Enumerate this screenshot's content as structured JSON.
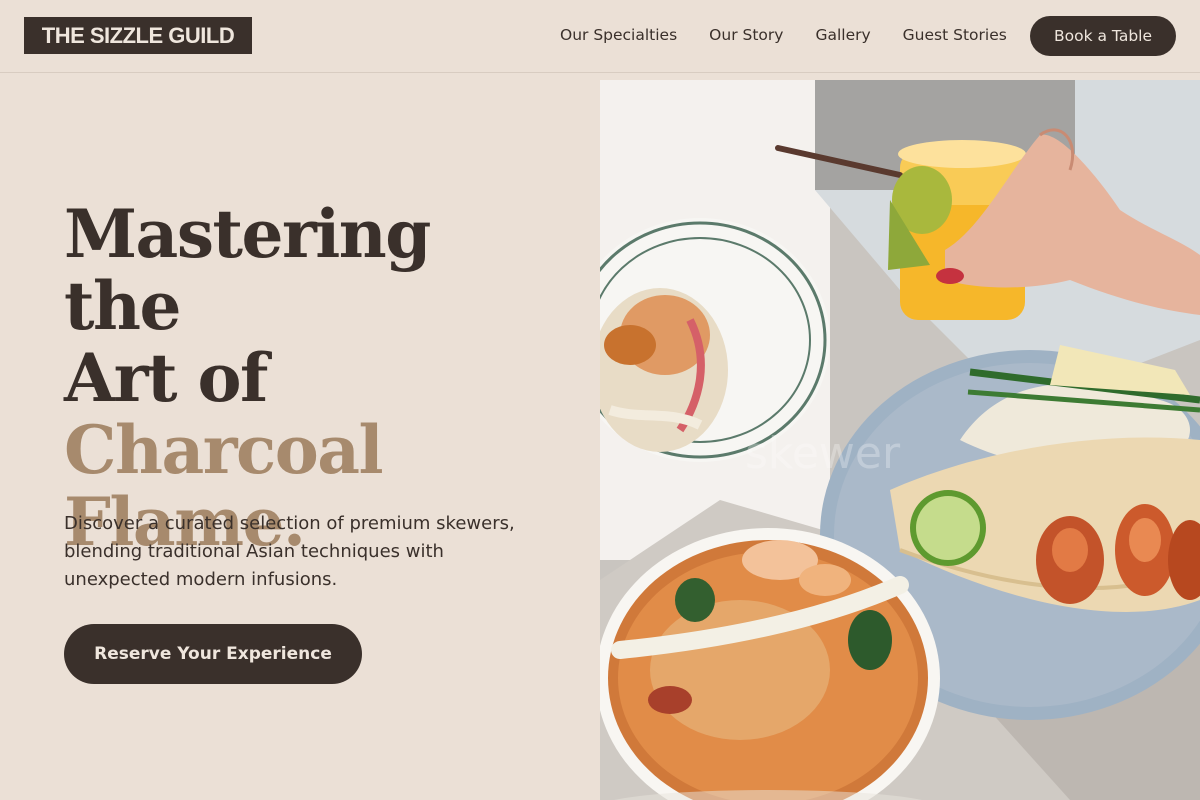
{
  "nav": {
    "logo": "THE SIZZLE GUILD",
    "links": [
      "Our Specialties",
      "Our Story",
      "Gallery",
      "Guest Stories"
    ],
    "book_label": "Book a Table"
  },
  "hero": {
    "title_lines_dark": [
      "Mastering the",
      "Art of"
    ],
    "title_lines_accent": [
      "Charcoal",
      "Flame."
    ],
    "subtitle": "Discover a curated selection of premium skewers, blending traditional Asian techniques with unexpected modern infusions.",
    "cta_label": "Reserve Your Experience",
    "image_watermark": "skewer"
  },
  "colors": {
    "background": "#ebe0d6",
    "dark": "#3a302b",
    "accent": "#a78a6d"
  }
}
